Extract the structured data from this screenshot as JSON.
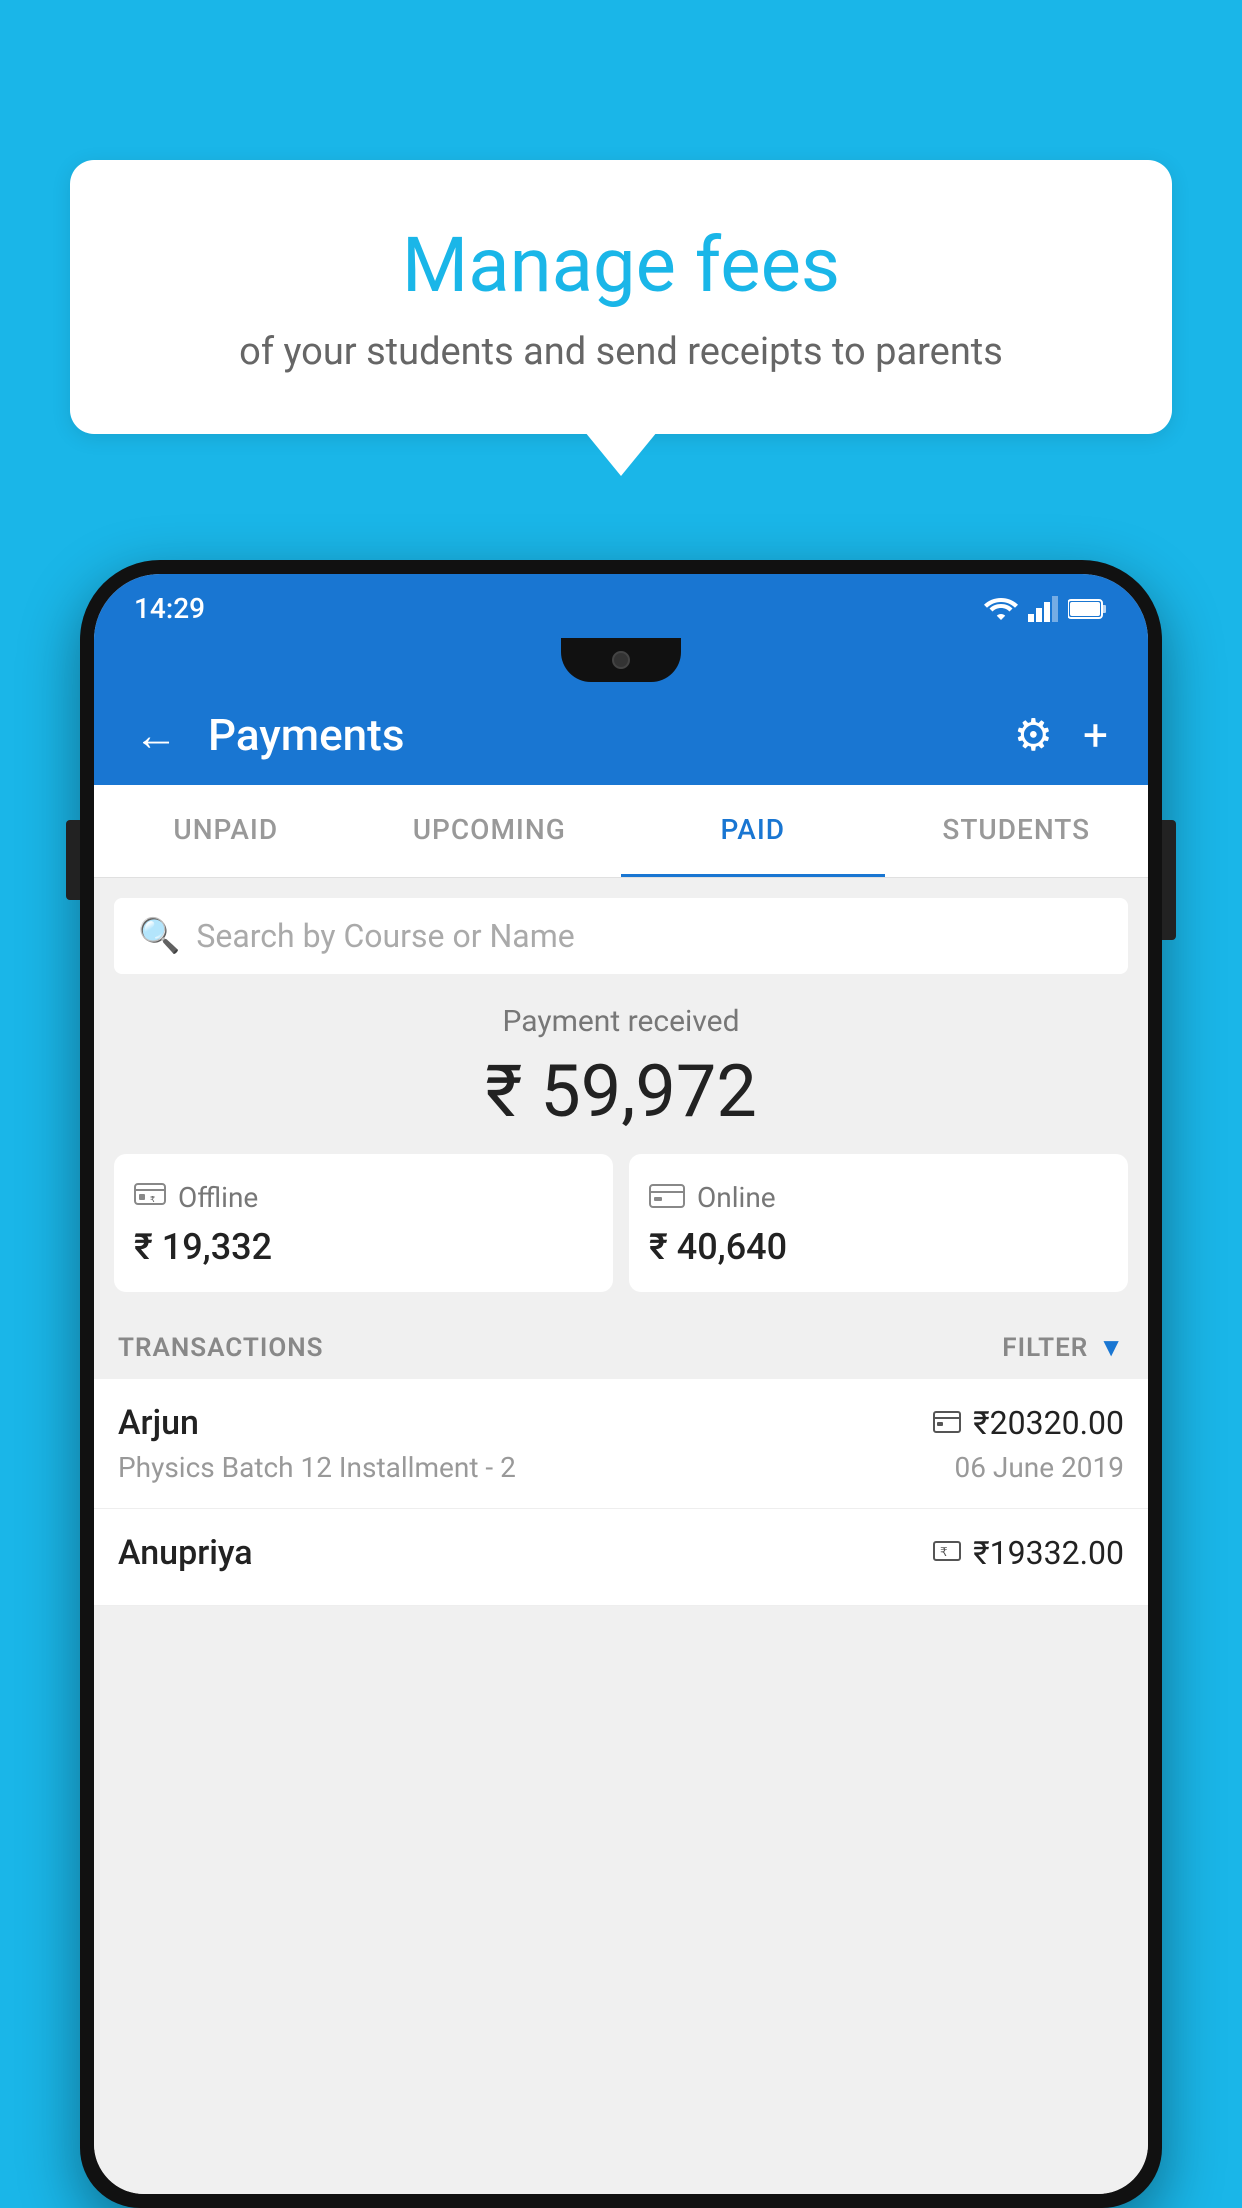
{
  "background_color": "#1ab6e8",
  "speech_bubble": {
    "title": "Manage fees",
    "subtitle": "of your students and send receipts to parents"
  },
  "phone": {
    "status_bar": {
      "time": "14:29"
    },
    "header": {
      "title": "Payments",
      "back_label": "←",
      "settings_icon": "⚙",
      "add_icon": "+"
    },
    "tabs": [
      {
        "label": "UNPAID",
        "active": false
      },
      {
        "label": "UPCOMING",
        "active": false
      },
      {
        "label": "PAID",
        "active": true
      },
      {
        "label": "STUDENTS",
        "active": false
      }
    ],
    "search": {
      "placeholder": "Search by Course or Name"
    },
    "payment_section": {
      "label": "Payment received",
      "amount": "₹ 59,972",
      "offline": {
        "icon": "💳",
        "label": "Offline",
        "amount": "₹ 19,332"
      },
      "online": {
        "icon": "💳",
        "label": "Online",
        "amount": "₹ 40,640"
      }
    },
    "transactions": {
      "label": "TRANSACTIONS",
      "filter_label": "FILTER",
      "items": [
        {
          "name": "Arjun",
          "course": "Physics Batch 12 Installment - 2",
          "amount": "₹20320.00",
          "date": "06 June 2019",
          "payment_type": "online"
        },
        {
          "name": "Anupriya",
          "course": "",
          "amount": "₹19332.00",
          "date": "",
          "payment_type": "offline"
        }
      ]
    }
  }
}
